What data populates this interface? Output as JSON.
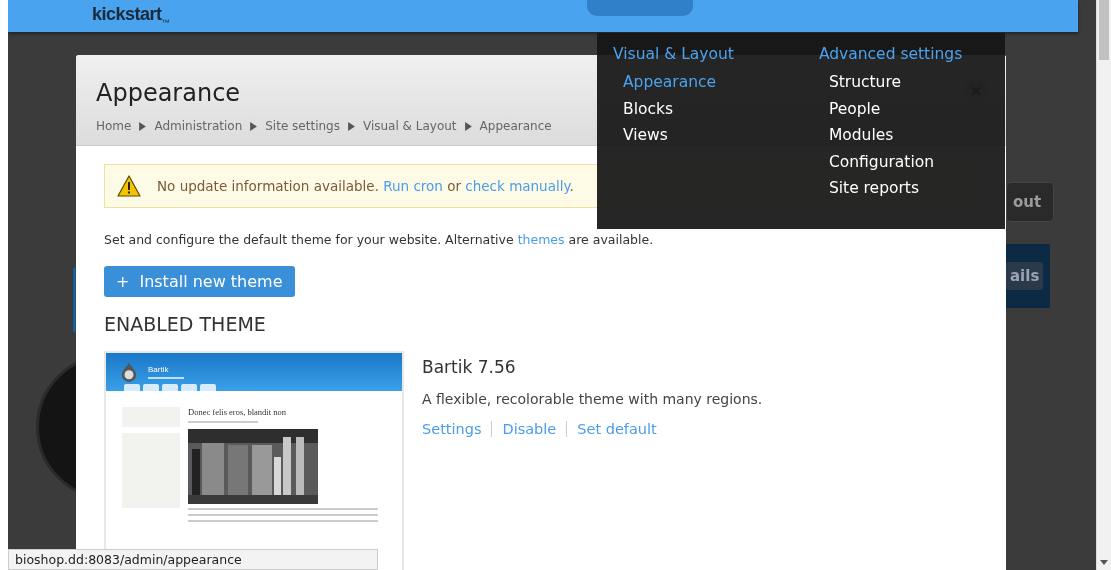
{
  "top_bar": {
    "logo": "kickstart$_{™}$"
  },
  "nav_menu": {
    "columns": [
      {
        "heading": "Visual & Layout",
        "items": [
          {
            "label": "Appearance",
            "selected": true
          },
          {
            "label": "Blocks",
            "selected": false
          },
          {
            "label": "Views",
            "selected": false
          }
        ]
      },
      {
        "heading": "Advanced settings",
        "items": [
          {
            "label": "Structure",
            "selected": false
          },
          {
            "label": "People",
            "selected": false
          },
          {
            "label": "Modules",
            "selected": false
          },
          {
            "label": "Configuration",
            "selected": false
          },
          {
            "label": "Site reports",
            "selected": false
          }
        ]
      }
    ]
  },
  "background": {
    "buttons": [
      "out",
      "ails"
    ]
  },
  "dialog": {
    "title": "Appearance",
    "breadcrumb": [
      "Home",
      "Administration",
      "Site settings",
      "Visual & Layout",
      "Appearance"
    ],
    "message": {
      "kind": "warning",
      "parts": [
        {
          "text": "No update information available. "
        },
        {
          "link": "Run cron"
        },
        {
          "text": " or "
        },
        {
          "link": "check manually"
        },
        {
          "text": "."
        }
      ]
    },
    "description": [
      {
        "text": "Set and configure the default theme for your website. Alternative "
      },
      {
        "link": "themes"
      },
      {
        "text": " are available."
      }
    ],
    "install_button": {
      "icon": "+",
      "label": "Install new theme"
    },
    "section_title": "ENABLED THEME",
    "theme": {
      "screenshot": {
        "site_name": "Bartik",
        "article_title": "Donec felis eros, blandit non"
      },
      "name": "Bartik 7.56",
      "description": "A flexible, recolorable theme with many regions.",
      "links": [
        "Settings",
        "Disable",
        "Set default"
      ]
    }
  },
  "status_bar": "bioshop.dd:8083/admin/appearance"
}
